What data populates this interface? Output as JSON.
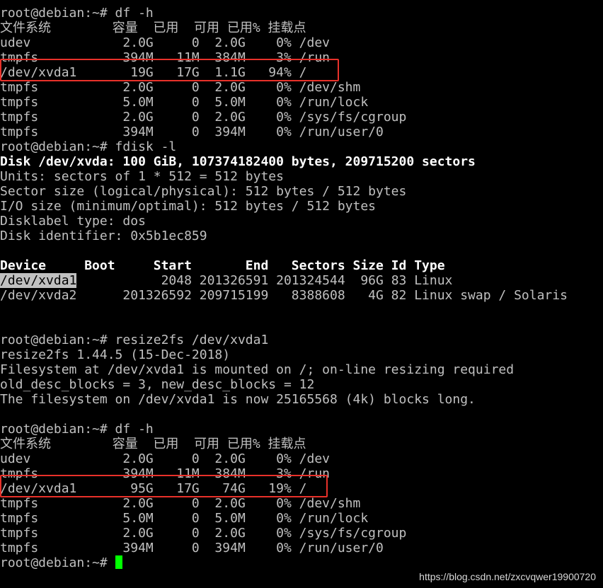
{
  "terminal": {
    "colors": {
      "background": "#000000",
      "foreground": "#c0c0c0",
      "bold": "#ffffff",
      "cursor": "#00ff00",
      "highlight_box": "#e8312a"
    },
    "lines": [
      "root@debian:~# df -h",
      "文件系统        容量  已用  可用 已用% 挂载点",
      "udev            2.0G     0  2.0G    0% /dev",
      "tmpfs           394M   11M  384M    3% /run",
      "/dev/xvda1       19G   17G  1.1G   94% /",
      "tmpfs           2.0G     0  2.0G    0% /dev/shm",
      "tmpfs           5.0M     0  5.0M    0% /run/lock",
      "tmpfs           2.0G     0  2.0G    0% /sys/fs/cgroup",
      "tmpfs           394M     0  394M    0% /run/user/0",
      "root@debian:~# fdisk -l",
      "Disk /dev/xvda: 100 GiB, 107374182400 bytes, 209715200 sectors",
      "Units: sectors of 1 * 512 = 512 bytes",
      "Sector size (logical/physical): 512 bytes / 512 bytes",
      "I/O size (minimum/optimal): 512 bytes / 512 bytes",
      "Disklabel type: dos",
      "Disk identifier: 0x5b1ec859",
      "",
      "Device     Boot     Start       End   Sectors Size Id Type",
      "/dev/xvda1           2048 201326591 201324544  96G 83 Linux",
      "/dev/xvda2      201326592 209715199   8388608   4G 82 Linux swap / Solaris",
      "",
      "",
      "root@debian:~# resize2fs /dev/xvda1",
      "resize2fs 1.44.5 (15-Dec-2018)",
      "Filesystem at /dev/xvda1 is mounted on /; on-line resizing required",
      "old_desc_blocks = 3, new_desc_blocks = 12",
      "The filesystem on /dev/xvda1 is now 25165568 (4k) blocks long.",
      "",
      "root@debian:~# df -h",
      "文件系统        容量  已用  可用 已用% 挂载点",
      "udev            2.0G     0  2.0G    0% /dev",
      "tmpfs           394M   11M  384M    3% /run",
      "/dev/xvda1       95G   17G   74G   19% /",
      "tmpfs           2.0G     0  2.0G    0% /dev/shm",
      "tmpfs           5.0M     0  5.0M    0% /run/lock",
      "tmpfs           2.0G     0  2.0G    0% /sys/fs/cgroup",
      "tmpfs           394M     0  394M    0% /run/user/0"
    ],
    "prompt": "root@debian:~# ",
    "bold_lines": [
      10,
      17
    ],
    "selected_text": {
      "line": 18,
      "text": "/dev/xvda1"
    }
  },
  "watermark": "https://blog.csdn.net/zxcvqwer19900720"
}
